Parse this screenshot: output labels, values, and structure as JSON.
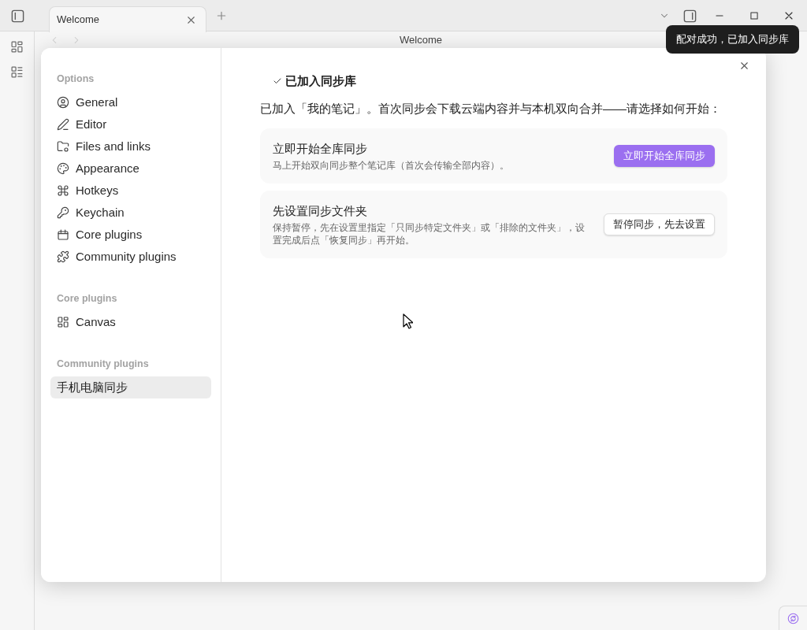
{
  "title_bar": {
    "tabs": [
      {
        "label": "Welcome",
        "selected": true
      }
    ]
  },
  "view_header": {
    "title": "Welcome"
  },
  "tooltip": {
    "text": "配对成功，已加入同步库"
  },
  "settings_modal": {
    "sidebar": {
      "groups": [
        {
          "heading": "Options",
          "items": [
            {
              "label": "General",
              "selected": false
            },
            {
              "label": "Editor",
              "selected": false
            },
            {
              "label": "Files and links",
              "selected": false
            },
            {
              "label": "Appearance",
              "selected": false
            },
            {
              "label": "Hotkeys",
              "selected": false
            },
            {
              "label": "Keychain",
              "selected": false
            },
            {
              "label": "Core plugins",
              "selected": false
            },
            {
              "label": "Community plugins",
              "selected": false
            }
          ]
        },
        {
          "heading": "Core plugins",
          "items": [
            {
              "label": "Canvas",
              "selected": false
            }
          ]
        },
        {
          "heading": "Community plugins",
          "items": [
            {
              "label": "手机电脑同步",
              "selected": true
            }
          ]
        }
      ]
    },
    "content": {
      "heading": "已加入同步库",
      "intro": "已加入「我的笔记」。首次同步会下载云端内容并与本机双向合并——请选择如何开始：",
      "options": [
        {
          "title": "立即开始全库同步",
          "description": "马上开始双向同步整个笔记库（首次会传输全部内容）。",
          "button": {
            "label": "立即开始全库同步",
            "kind": "primary"
          }
        },
        {
          "title": "先设置同步文件夹",
          "description": "保持暂停，先在设置里指定「只同步特定文件夹」或「排除的文件夹」，设置完成后点「恢复同步」再开始。",
          "button": {
            "label": "暂停同步，先去设置",
            "kind": "default"
          }
        }
      ]
    }
  }
}
